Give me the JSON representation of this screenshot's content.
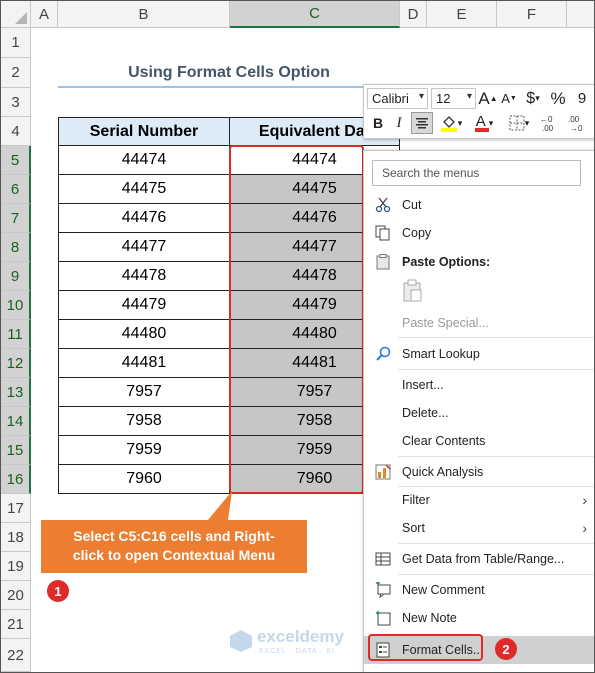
{
  "sheet": {
    "columns": [
      "A",
      "B",
      "C",
      "D",
      "E",
      "F"
    ],
    "rows": [
      "1",
      "2",
      "3",
      "4",
      "5",
      "6",
      "7",
      "8",
      "9",
      "10",
      "11",
      "12",
      "13",
      "14",
      "15",
      "16",
      "17",
      "18",
      "19",
      "20",
      "21",
      "22"
    ],
    "title": "Using Format Cells Option",
    "headers": {
      "serial": "Serial Number",
      "equivalent": "Equivalent Dat"
    },
    "serial_numbers": [
      "44474",
      "44475",
      "44476",
      "44477",
      "44478",
      "44479",
      "44480",
      "44481",
      "7957",
      "7958",
      "7959",
      "7960"
    ],
    "equivalent_values": [
      "44474",
      "44475",
      "44476",
      "44477",
      "44478",
      "44479",
      "44480",
      "44481",
      "7957",
      "7958",
      "7959",
      "7960"
    ]
  },
  "mini_toolbar": {
    "font": "Calibri",
    "size": "12",
    "grow_font": "A",
    "shrink_font": "A",
    "currency": "$",
    "percent": "%",
    "comma": "9",
    "bold": "B",
    "italic": "I",
    "font_color": "A"
  },
  "context_menu": {
    "search_placeholder": "Search the menus",
    "items": {
      "cut": "Cut",
      "copy": "Copy",
      "paste_options": "Paste Options:",
      "paste_special": "Paste Special...",
      "smart_lookup": "Smart Lookup",
      "insert": "Insert...",
      "delete": "Delete...",
      "clear_contents": "Clear Contents",
      "quick_analysis": "Quick Analysis",
      "filter": "Filter",
      "sort": "Sort",
      "get_data": "Get Data from Table/Range...",
      "new_comment": "New Comment",
      "new_note": "New Note",
      "format_cells": "Format Cells..."
    }
  },
  "annotations": {
    "callout_line1": "Select C5:C16 cells and Right-",
    "callout_line2": "click to open Contextual Menu",
    "step1": "1",
    "step2": "2"
  },
  "watermark": {
    "name": "exceldemy",
    "tagline": "EXCEL · DATA · BI"
  },
  "colors": {
    "accent": "#217346",
    "header_fill": "#ddebf7",
    "selection_fill": "#c6c6c6",
    "callout": "#ed7d31",
    "highlight": "#e02a2a"
  }
}
